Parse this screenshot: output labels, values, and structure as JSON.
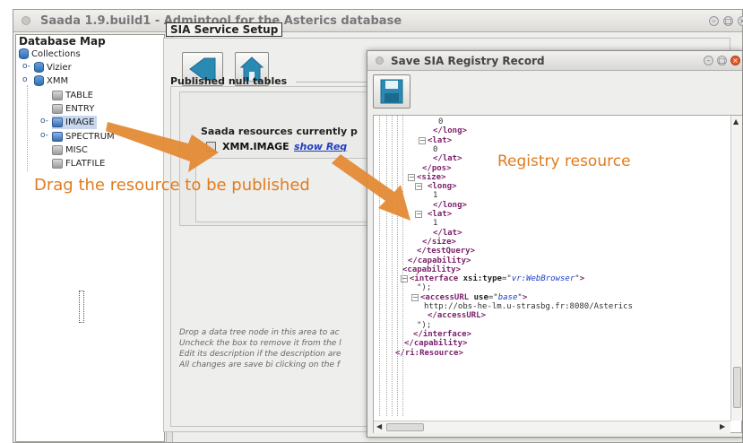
{
  "window": {
    "title": "Saada 1.9.build1 - Admintool for the Asterics database",
    "buttons": [
      "–",
      "□",
      "×"
    ]
  },
  "db_map": {
    "header": "Database Map",
    "items": [
      {
        "label": "Collections",
        "icon": "database-icon"
      },
      {
        "label": "Vizier",
        "icon": "database-icon"
      },
      {
        "label": "XMM",
        "icon": "database-icon"
      },
      {
        "label": "TABLE",
        "icon": "table-icon"
      },
      {
        "label": "ENTRY",
        "icon": "table-icon"
      },
      {
        "label": "IMAGE",
        "icon": "table-icon",
        "selected": true
      },
      {
        "label": "SPECTRUM",
        "icon": "table-icon"
      },
      {
        "label": "MISC",
        "icon": "table-icon"
      },
      {
        "label": "FLATFILE",
        "icon": "table-icon"
      }
    ]
  },
  "sia": {
    "tab": "SIA Service Setup",
    "toolbar": {
      "back_icon": "back-arrow-icon",
      "home_icon": "home-icon"
    },
    "published_label": "Published null tables",
    "resources_label": "Saada resources currently p",
    "resource_row": {
      "name": "XMM.IMAGE",
      "link": "show Req"
    },
    "help_lines": [
      "Drop a data tree node in this area to ac",
      "Uncheck the box to remove it from the l",
      "Edit its description if the description are",
      "All changes are save bi clicking on the f"
    ]
  },
  "dialog": {
    "title": "Save SIA Registry Record",
    "save_icon": "floppy-disk-icon",
    "xml_lines": [
      {
        "t": "0"
      },
      {
        "t": "</long>"
      },
      {
        "t": "<lat>"
      },
      {
        "t": "0"
      },
      {
        "t": "</lat>"
      },
      {
        "t": "</pos>"
      },
      {
        "t": "<size>"
      },
      {
        "t": "<long>"
      },
      {
        "t": "1"
      },
      {
        "t": "</long>"
      },
      {
        "t": "<lat>"
      },
      {
        "t": "1"
      },
      {
        "t": "</lat>"
      },
      {
        "t": "</size>"
      },
      {
        "t": "</testQuery>"
      },
      {
        "t": "</capability>"
      },
      {
        "t": "<capability>"
      },
      {
        "t": "<interface xsi:type=\"vr:WebBrowser\">"
      },
      {
        "t": "\");"
      },
      {
        "t": "<accessURL use=\"base\">"
      },
      {
        "t": "http://obs-he-lm.u-strasbg.fr:8080/Asterics"
      },
      {
        "t": "</accessURL>"
      },
      {
        "t": "\");"
      },
      {
        "t": "</interface>"
      },
      {
        "t": "</capability>"
      },
      {
        "t": "</ri:Resource>"
      }
    ]
  },
  "annotations": {
    "registry": "Registry resource",
    "drag": "Drag the resource to be published"
  },
  "colors": {
    "annotation": "#e07c1f",
    "tag": "#7a1f6a",
    "attr_value": "#1a3bcc",
    "link": "#1e3fbf",
    "selection": "#c8d7ee"
  }
}
